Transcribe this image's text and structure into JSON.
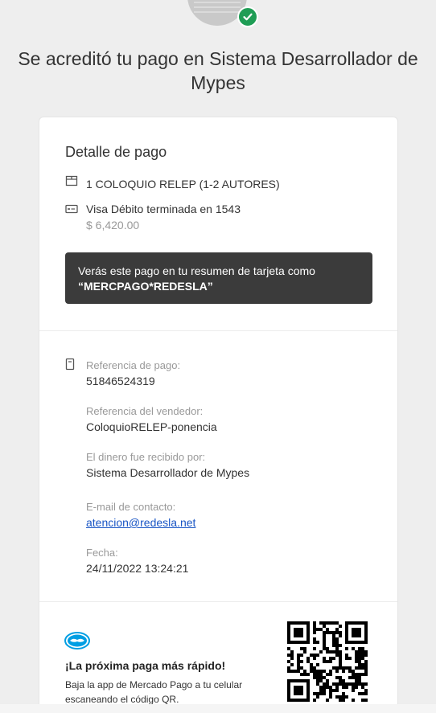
{
  "header": {
    "title": "Se acreditó tu pago en Sistema Desarrollador de Mypes"
  },
  "detail": {
    "title": "Detalle de pago",
    "item": "1 COLOQUIO RELEP (1-2 AUTORES)",
    "payment_method": "Visa Débito terminada en 1543",
    "amount": "$ 6,420.00",
    "notice_line1": "Verás este pago en tu resumen de tarjeta como",
    "notice_line2": "“MERCPAGO*REDESLA”"
  },
  "references": {
    "payment_ref_label": "Referencia de pago:",
    "payment_ref_value": "51846524319",
    "seller_ref_label": "Referencia del vendedor:",
    "seller_ref_value": "ColoquioRELEP-ponencia",
    "receiver_label": "El dinero fue recibido por:",
    "receiver_value": "Sistema Desarrollador de Mypes",
    "email_label": "E-mail de contacto:",
    "email_value": "atencion@redesla.net",
    "date_label": "Fecha:",
    "date_value": "24/11/2022 13:24:21"
  },
  "promo": {
    "title": "¡La próxima paga más rápido!",
    "text": "Baja la app de Mercado Pago a tu celular escaneando el código QR."
  },
  "icons": {
    "status": "check-icon",
    "item": "box-icon",
    "card": "credit-card-icon",
    "receipt": "receipt-icon",
    "brand": "mercado-pago-logo",
    "qr": "qr-code"
  },
  "colors": {
    "success": "#1f9d55",
    "notice_bg": "#3b3b3b",
    "link": "#1a56c5",
    "brand": "#009ee3"
  }
}
